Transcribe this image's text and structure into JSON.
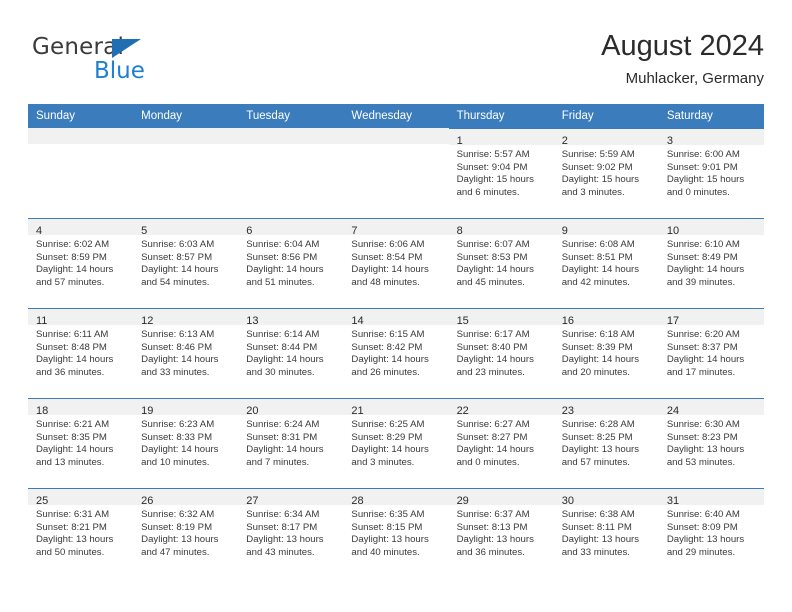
{
  "brand": {
    "name_top": "General",
    "name_bottom": "Blue",
    "triangle_color": "#1f6fb2",
    "blue_color": "#1f7fd0"
  },
  "header": {
    "title": "August 2024",
    "subtitle": "Muhlacker, Germany"
  },
  "theme": {
    "header_row_bg": "#3b7cbd",
    "daynum_band_bg": "#f1f1f1",
    "cell_border": "#3b7cbd",
    "text": "#2b2b2b"
  },
  "weekday_headers": [
    "Sunday",
    "Monday",
    "Tuesday",
    "Wednesday",
    "Thursday",
    "Friday",
    "Saturday"
  ],
  "weeks": [
    [
      {
        "day": "",
        "empty": true
      },
      {
        "day": "",
        "empty": true
      },
      {
        "day": "",
        "empty": true
      },
      {
        "day": "",
        "empty": true
      },
      {
        "day": "1",
        "sunrise": "Sunrise: 5:57 AM",
        "sunset": "Sunset: 9:04 PM",
        "daylight": "Daylight: 15 hours and 6 minutes."
      },
      {
        "day": "2",
        "sunrise": "Sunrise: 5:59 AM",
        "sunset": "Sunset: 9:02 PM",
        "daylight": "Daylight: 15 hours and 3 minutes."
      },
      {
        "day": "3",
        "sunrise": "Sunrise: 6:00 AM",
        "sunset": "Sunset: 9:01 PM",
        "daylight": "Daylight: 15 hours and 0 minutes."
      }
    ],
    [
      {
        "day": "4",
        "sunrise": "Sunrise: 6:02 AM",
        "sunset": "Sunset: 8:59 PM",
        "daylight": "Daylight: 14 hours and 57 minutes."
      },
      {
        "day": "5",
        "sunrise": "Sunrise: 6:03 AM",
        "sunset": "Sunset: 8:57 PM",
        "daylight": "Daylight: 14 hours and 54 minutes."
      },
      {
        "day": "6",
        "sunrise": "Sunrise: 6:04 AM",
        "sunset": "Sunset: 8:56 PM",
        "daylight": "Daylight: 14 hours and 51 minutes."
      },
      {
        "day": "7",
        "sunrise": "Sunrise: 6:06 AM",
        "sunset": "Sunset: 8:54 PM",
        "daylight": "Daylight: 14 hours and 48 minutes."
      },
      {
        "day": "8",
        "sunrise": "Sunrise: 6:07 AM",
        "sunset": "Sunset: 8:53 PM",
        "daylight": "Daylight: 14 hours and 45 minutes."
      },
      {
        "day": "9",
        "sunrise": "Sunrise: 6:08 AM",
        "sunset": "Sunset: 8:51 PM",
        "daylight": "Daylight: 14 hours and 42 minutes."
      },
      {
        "day": "10",
        "sunrise": "Sunrise: 6:10 AM",
        "sunset": "Sunset: 8:49 PM",
        "daylight": "Daylight: 14 hours and 39 minutes."
      }
    ],
    [
      {
        "day": "11",
        "sunrise": "Sunrise: 6:11 AM",
        "sunset": "Sunset: 8:48 PM",
        "daylight": "Daylight: 14 hours and 36 minutes."
      },
      {
        "day": "12",
        "sunrise": "Sunrise: 6:13 AM",
        "sunset": "Sunset: 8:46 PM",
        "daylight": "Daylight: 14 hours and 33 minutes."
      },
      {
        "day": "13",
        "sunrise": "Sunrise: 6:14 AM",
        "sunset": "Sunset: 8:44 PM",
        "daylight": "Daylight: 14 hours and 30 minutes."
      },
      {
        "day": "14",
        "sunrise": "Sunrise: 6:15 AM",
        "sunset": "Sunset: 8:42 PM",
        "daylight": "Daylight: 14 hours and 26 minutes."
      },
      {
        "day": "15",
        "sunrise": "Sunrise: 6:17 AM",
        "sunset": "Sunset: 8:40 PM",
        "daylight": "Daylight: 14 hours and 23 minutes."
      },
      {
        "day": "16",
        "sunrise": "Sunrise: 6:18 AM",
        "sunset": "Sunset: 8:39 PM",
        "daylight": "Daylight: 14 hours and 20 minutes."
      },
      {
        "day": "17",
        "sunrise": "Sunrise: 6:20 AM",
        "sunset": "Sunset: 8:37 PM",
        "daylight": "Daylight: 14 hours and 17 minutes."
      }
    ],
    [
      {
        "day": "18",
        "sunrise": "Sunrise: 6:21 AM",
        "sunset": "Sunset: 8:35 PM",
        "daylight": "Daylight: 14 hours and 13 minutes."
      },
      {
        "day": "19",
        "sunrise": "Sunrise: 6:23 AM",
        "sunset": "Sunset: 8:33 PM",
        "daylight": "Daylight: 14 hours and 10 minutes."
      },
      {
        "day": "20",
        "sunrise": "Sunrise: 6:24 AM",
        "sunset": "Sunset: 8:31 PM",
        "daylight": "Daylight: 14 hours and 7 minutes."
      },
      {
        "day": "21",
        "sunrise": "Sunrise: 6:25 AM",
        "sunset": "Sunset: 8:29 PM",
        "daylight": "Daylight: 14 hours and 3 minutes."
      },
      {
        "day": "22",
        "sunrise": "Sunrise: 6:27 AM",
        "sunset": "Sunset: 8:27 PM",
        "daylight": "Daylight: 14 hours and 0 minutes."
      },
      {
        "day": "23",
        "sunrise": "Sunrise: 6:28 AM",
        "sunset": "Sunset: 8:25 PM",
        "daylight": "Daylight: 13 hours and 57 minutes."
      },
      {
        "day": "24",
        "sunrise": "Sunrise: 6:30 AM",
        "sunset": "Sunset: 8:23 PM",
        "daylight": "Daylight: 13 hours and 53 minutes."
      }
    ],
    [
      {
        "day": "25",
        "sunrise": "Sunrise: 6:31 AM",
        "sunset": "Sunset: 8:21 PM",
        "daylight": "Daylight: 13 hours and 50 minutes."
      },
      {
        "day": "26",
        "sunrise": "Sunrise: 6:32 AM",
        "sunset": "Sunset: 8:19 PM",
        "daylight": "Daylight: 13 hours and 47 minutes."
      },
      {
        "day": "27",
        "sunrise": "Sunrise: 6:34 AM",
        "sunset": "Sunset: 8:17 PM",
        "daylight": "Daylight: 13 hours and 43 minutes."
      },
      {
        "day": "28",
        "sunrise": "Sunrise: 6:35 AM",
        "sunset": "Sunset: 8:15 PM",
        "daylight": "Daylight: 13 hours and 40 minutes."
      },
      {
        "day": "29",
        "sunrise": "Sunrise: 6:37 AM",
        "sunset": "Sunset: 8:13 PM",
        "daylight": "Daylight: 13 hours and 36 minutes."
      },
      {
        "day": "30",
        "sunrise": "Sunrise: 6:38 AM",
        "sunset": "Sunset: 8:11 PM",
        "daylight": "Daylight: 13 hours and 33 minutes."
      },
      {
        "day": "31",
        "sunrise": "Sunrise: 6:40 AM",
        "sunset": "Sunset: 8:09 PM",
        "daylight": "Daylight: 13 hours and 29 minutes."
      }
    ]
  ]
}
